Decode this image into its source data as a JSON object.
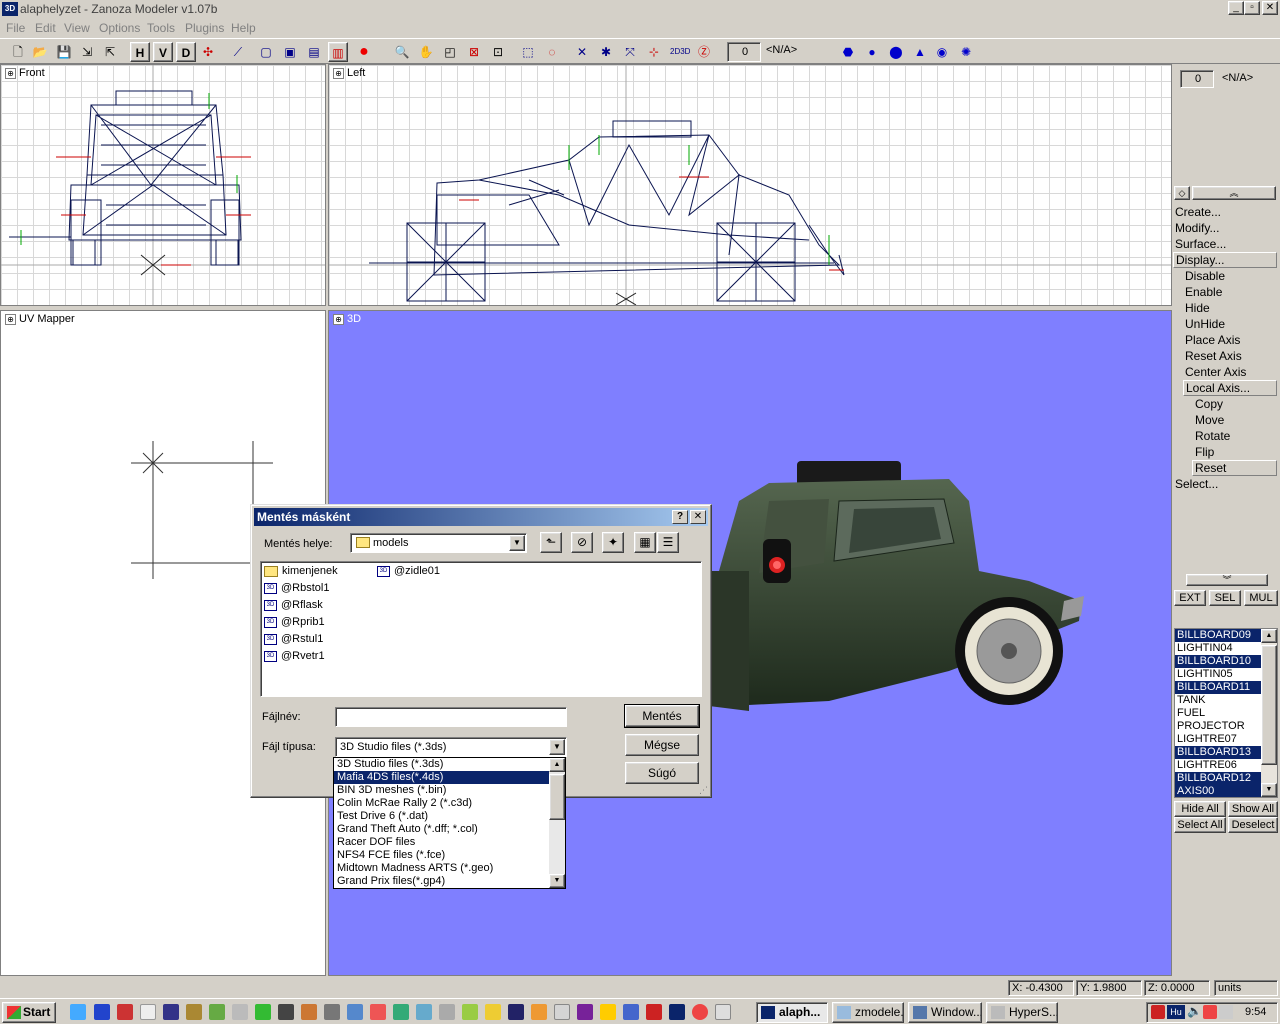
{
  "window": {
    "title": "alaphelyzet - Zanoza Modeler v1.07b",
    "app_icon": "3D"
  },
  "menu": [
    "File",
    "Edit",
    "View",
    "Options",
    "Tools",
    "Plugins",
    "Help"
  ],
  "toolbar": {
    "h": "H",
    "v": "V",
    "d": "D",
    "counter": "0",
    "na": "<N/A>"
  },
  "viewports": {
    "front": "Front",
    "left": "Left",
    "uv": "UV Mapper",
    "view3d": "3D"
  },
  "side": {
    "counter": "0",
    "na": "<N/A>",
    "menu": [
      "Create...",
      "Modify...",
      "Surface...",
      "Display...",
      "Disable",
      "Enable",
      "Hide",
      "UnHide",
      "Place Axis",
      "Reset Axis",
      "Center Axis",
      "Local Axis...",
      "Copy",
      "Move",
      "Rotate",
      "Flip",
      "Reset",
      "Select..."
    ],
    "ext": "EXT",
    "sel": "SEL",
    "mul": "MUL",
    "objects": [
      {
        "name": "BILLBOARD09",
        "selected": true
      },
      {
        "name": "LIGHTIN04",
        "selected": false
      },
      {
        "name": "BILLBOARD10",
        "selected": true
      },
      {
        "name": "LIGHTIN05",
        "selected": false
      },
      {
        "name": "BILLBOARD11",
        "selected": true
      },
      {
        "name": "TANK",
        "selected": false
      },
      {
        "name": "FUEL",
        "selected": false
      },
      {
        "name": "PROJECTOR",
        "selected": false
      },
      {
        "name": "LIGHTRE07",
        "selected": false
      },
      {
        "name": "BILLBOARD13",
        "selected": true
      },
      {
        "name": "LIGHTRE06",
        "selected": false
      },
      {
        "name": "BILLBOARD12",
        "selected": true
      },
      {
        "name": "AXIS00",
        "selected": true
      }
    ],
    "hide_all": "Hide All",
    "show_all": "Show All",
    "select_all": "Select All",
    "deselect": "Deselect"
  },
  "dialog": {
    "title": "Mentés másként",
    "help_btn": "?",
    "close_btn": "✕",
    "location_label": "Mentés helye:",
    "location_value": "models",
    "files": [
      {
        "name": "kimenjenek",
        "type": "folder"
      },
      {
        "name": "@Rbstol1",
        "type": "file"
      },
      {
        "name": "@Rflask",
        "type": "file"
      },
      {
        "name": "@Rprib1",
        "type": "file"
      },
      {
        "name": "@Rstul1",
        "type": "file"
      },
      {
        "name": "@Rvetr1",
        "type": "file"
      },
      {
        "name": "@zidle01",
        "type": "file"
      }
    ],
    "filename_label": "Fájlnév:",
    "filename_value": "",
    "filetype_label": "Fájl típusa:",
    "filetype_value": "3D Studio files (*.3ds)",
    "save_btn": "Mentés",
    "cancel_btn": "Mégse",
    "help_text_btn": "Súgó",
    "filetype_options": [
      "3D Studio files (*.3ds)",
      "Mafia 4DS files(*.4ds)",
      "BIN 3D meshes (*.bin)",
      "Colin McRae Rally 2 (*.c3d)",
      "Test Drive 6 (*.dat)",
      "Grand Theft Auto (*.dff; *.col)",
      "Racer DOF files",
      "NFS4 FCE files (*.fce)",
      "Midtown Madness ARTS (*.geo)",
      "Grand Prix files(*.gp4)"
    ],
    "highlighted_option": 1
  },
  "status": {
    "x": "X: -0.4300",
    "y": "Y: 1.9800",
    "z": "Z: 0.0000",
    "units": "units"
  },
  "taskbar": {
    "start": "Start",
    "tasks": [
      "alaph...",
      "zmodele...",
      "Window...",
      "HyperS..."
    ],
    "clock": "9:54",
    "lang": "Hu"
  },
  "colors": {
    "view3d_bg": "#7f7fff",
    "highlight": "#0a246a",
    "car_body": "#3a4a38"
  }
}
